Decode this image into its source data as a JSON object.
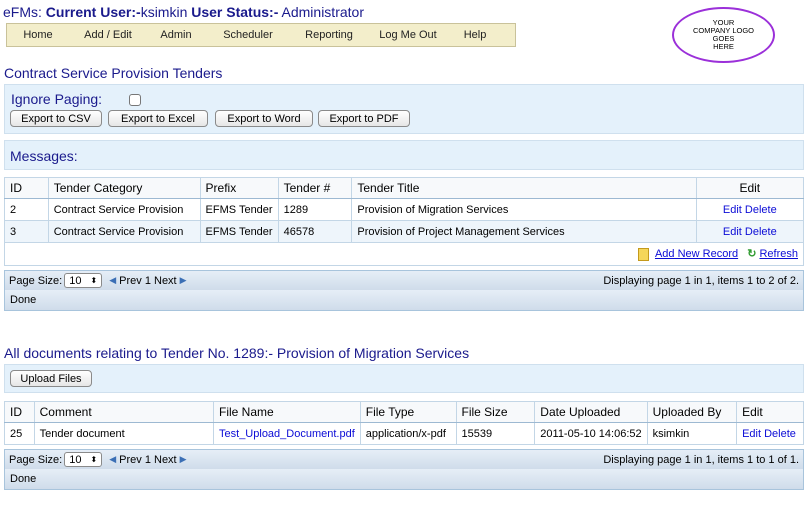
{
  "header": {
    "app": "eFMs:",
    "current_user_label": "Current User:-",
    "current_user": "ksimkin",
    "status_label": "User Status:-",
    "status": "Administrator"
  },
  "nav": {
    "items": [
      "Home",
      "Add / Edit",
      "Admin",
      "Scheduler",
      "Reporting",
      "Log Me Out",
      "Help"
    ]
  },
  "logo": {
    "line1": "YOUR",
    "line2": "COMPANY LOGO",
    "line3": "GOES",
    "line4": "HERE"
  },
  "tenders": {
    "title": "Contract Service Provision Tenders",
    "ignore_paging_label": "Ignore Paging:",
    "buttons": {
      "csv": "Export to CSV",
      "excel": "Export to Excel",
      "word": "Export to Word",
      "pdf": "Export to PDF"
    },
    "messages_label": "Messages:",
    "columns": [
      "ID",
      "Tender Category",
      "Prefix",
      "Tender #",
      "Tender Title",
      "Edit"
    ],
    "rows": [
      {
        "id": "2",
        "category": "Contract Service Provision",
        "prefix": "EFMS Tender",
        "num": "1289",
        "title": "Provision of Migration Services",
        "edit": "Edit",
        "delete": "Delete"
      },
      {
        "id": "3",
        "category": "Contract Service Provision",
        "prefix": "EFMS Tender",
        "num": "46578",
        "title": "Provision of Project Management Services",
        "edit": "Edit",
        "delete": "Delete"
      }
    ],
    "add_new": "Add New Record",
    "refresh": "Refresh",
    "pager": {
      "page_size_label": "Page Size:",
      "page_size": "10",
      "prev": "Prev",
      "page": "1",
      "next": "Next",
      "summary": "Displaying page 1 in 1, items 1 to 2 of 2."
    },
    "status": "Done"
  },
  "documents": {
    "title": "All documents relating to Tender No. 1289:- Provision of Migration Services",
    "upload_button": "Upload Files",
    "columns": [
      "ID",
      "Comment",
      "File Name",
      "File Type",
      "File Size",
      "Date Uploaded",
      "Uploaded By",
      "Edit"
    ],
    "rows": [
      {
        "id": "25",
        "comment": "Tender document",
        "file_name": "Test_Upload_Document.pdf",
        "file_type": "application/x-pdf",
        "file_size": "15539",
        "date": "2011-05-10 14:06:52",
        "by": "ksimkin",
        "edit": "Edit",
        "delete": "Delete"
      }
    ],
    "pager": {
      "page_size_label": "Page Size:",
      "page_size": "10",
      "prev": "Prev",
      "page": "1",
      "next": "Next",
      "summary": "Displaying page 1 in 1, items 1 to 1 of 1."
    },
    "status": "Done"
  }
}
